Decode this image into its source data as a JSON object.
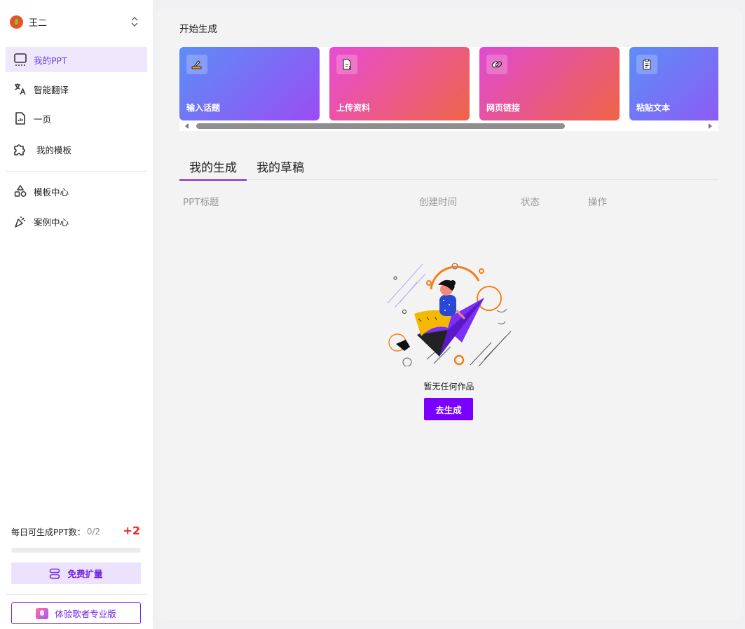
{
  "user": {
    "name": "王二"
  },
  "sidebar": {
    "items": [
      {
        "label": "我的PPT",
        "icon": "monitor-icon",
        "active": true
      },
      {
        "label": "智能翻译",
        "icon": "translate-icon",
        "active": false
      },
      {
        "label": "一页",
        "icon": "file-chart-icon",
        "active": false
      },
      {
        "label": "我的模板",
        "icon": "puzzle-icon",
        "active": false
      },
      {
        "label": "模板中心",
        "icon": "shapes-icon",
        "active": false
      },
      {
        "label": "案例中心",
        "icon": "party-popper-icon",
        "active": false
      }
    ],
    "quota_label": "每日可生成PPT数：",
    "quota_value": "0/2",
    "quota_bonus": "+2",
    "quota_progress": 0.0,
    "expand_label": "免费扩量",
    "pro_label": "体验歌者专业版"
  },
  "main": {
    "section_title": "开始生成",
    "cards": [
      {
        "label": "输入话题",
        "icon": "pen-icon",
        "gradient": [
          "#5b8ef7",
          "#9b4cf3"
        ]
      },
      {
        "label": "上传资料",
        "icon": "upload-file-icon",
        "gradient": [
          "#e94bd6",
          "#ee6548"
        ]
      },
      {
        "label": "网页链接",
        "icon": "link-icon",
        "gradient": [
          "#e04ad3",
          "#ef6445"
        ]
      },
      {
        "label": "粘贴文本",
        "icon": "clipboard-icon",
        "gradient": [
          "#5b8ef7",
          "#9b4cf3"
        ]
      }
    ],
    "tabs": [
      {
        "label": "我的生成",
        "active": true
      },
      {
        "label": "我的草稿",
        "active": false
      }
    ],
    "columns": [
      "PPT标题",
      "创建时间",
      "状态",
      "操作"
    ],
    "empty_text": "暂无任何作品",
    "go_button": "去生成"
  },
  "colors": {
    "accent": "#7426e8",
    "primary_button": "#7900ff",
    "active_bg": "#efe8fd"
  }
}
